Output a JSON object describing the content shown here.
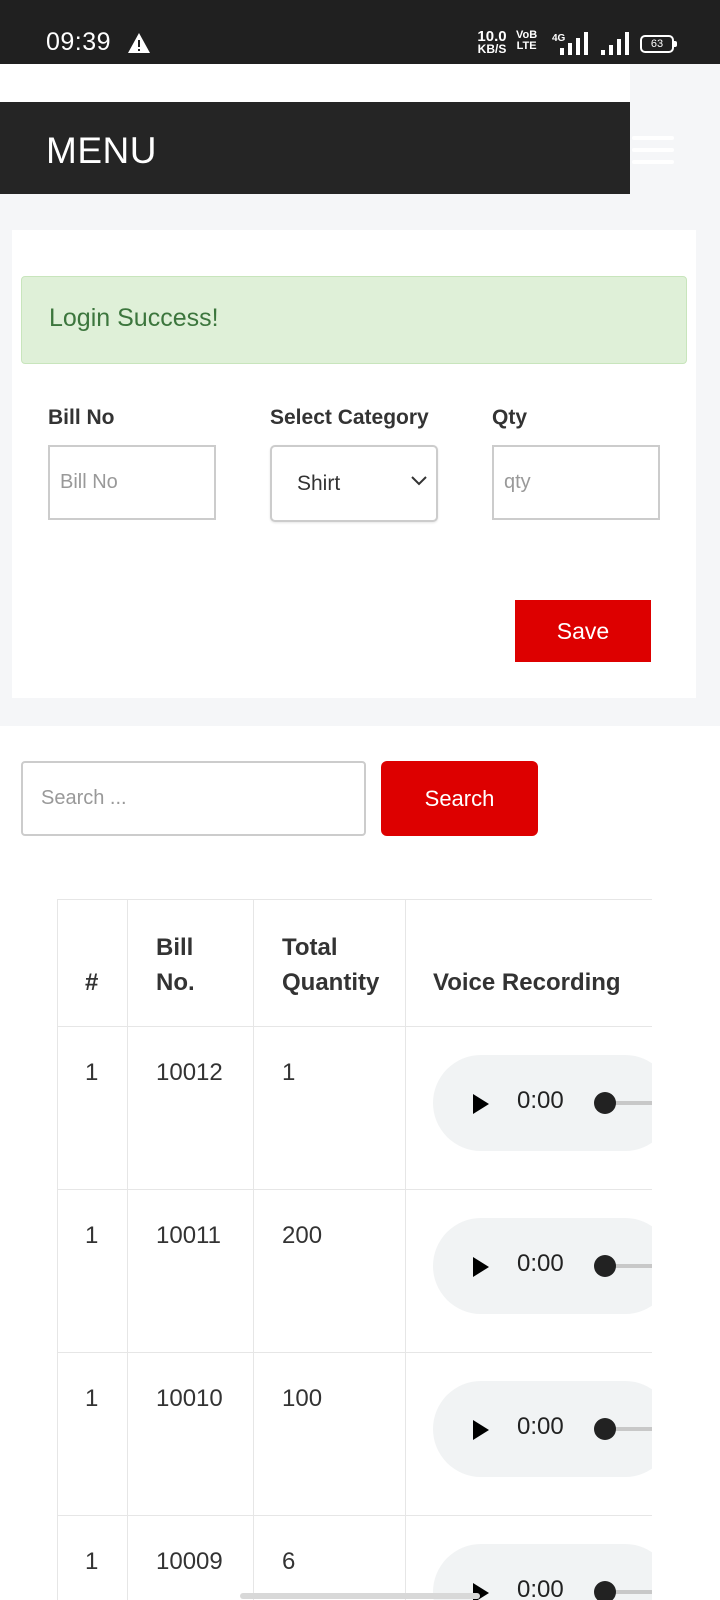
{
  "status_bar": {
    "time": "09:39",
    "net_speed_value": "10.0",
    "net_speed_unit": "KB/S",
    "volte_top": "VoB",
    "volte_bottom": "LTE",
    "network": "4G",
    "battery": "63"
  },
  "nav": {
    "title": "MENU",
    "menu_icon": "hamburger-icon"
  },
  "alert": {
    "message": "Login Success!",
    "color": "#3c763d"
  },
  "form": {
    "bill_no_label": "Bill No",
    "bill_no_placeholder": "Bill No",
    "category_label": "Select Category",
    "category_selected": "Shirt",
    "qty_label": "Qty",
    "qty_placeholder": "qty",
    "save_label": "Save"
  },
  "search": {
    "placeholder": "Search ...",
    "button_label": "Search"
  },
  "table": {
    "headers": {
      "num": "#",
      "bill_line1": "Bill",
      "bill_line2": "No.",
      "total_line1": "Total",
      "total_line2": "Quantity",
      "voice": "Voice Recording"
    },
    "rows": [
      {
        "num": "1",
        "bill": "10012",
        "qty": "1",
        "audio_time": "0:00"
      },
      {
        "num": "1",
        "bill": "10011",
        "qty": "200",
        "audio_time": "0:00"
      },
      {
        "num": "1",
        "bill": "10010",
        "qty": "100",
        "audio_time": "0:00"
      },
      {
        "num": "1",
        "bill": "10009",
        "qty": "6",
        "audio_time": "0:00"
      }
    ]
  },
  "colors": {
    "accent_red": "#dd0000",
    "nav_dark": "#252525",
    "alert_bg": "#dff0d8"
  }
}
